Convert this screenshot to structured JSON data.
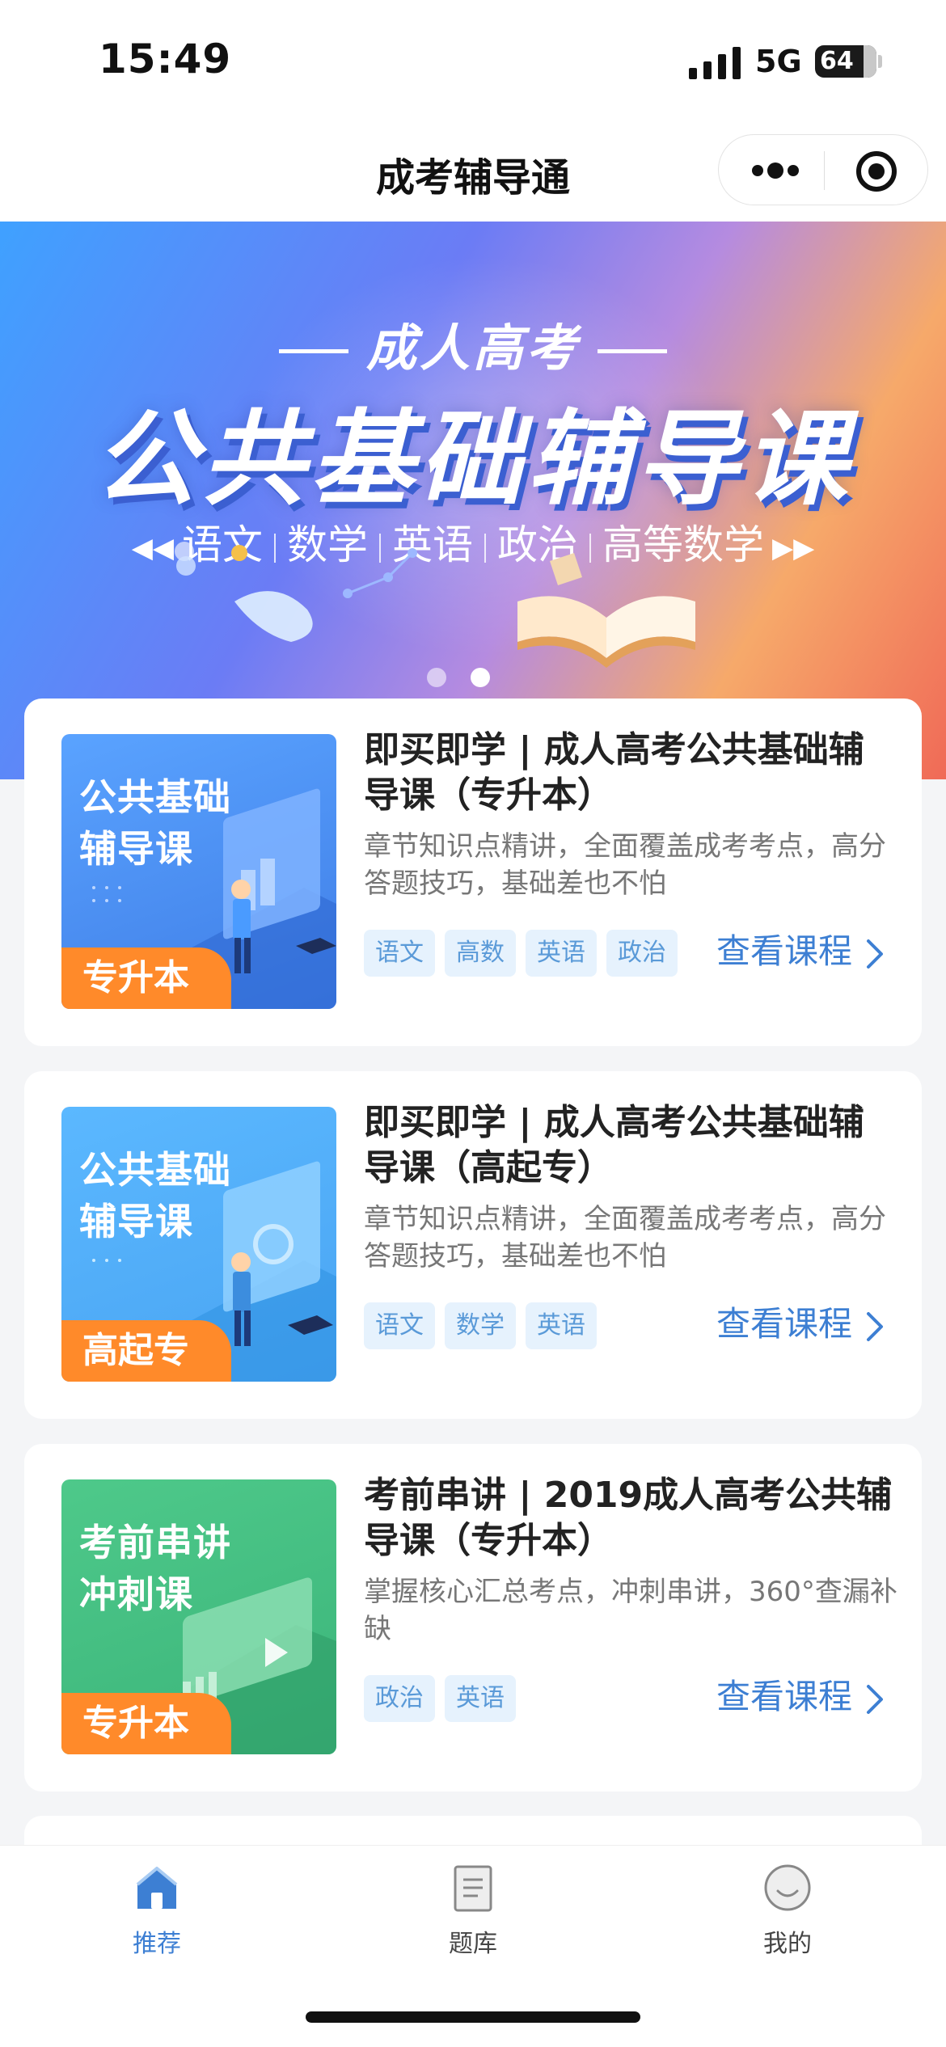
{
  "status_bar": {
    "time": "15:49",
    "network": "5G",
    "battery": "64"
  },
  "nav": {
    "title": "成考辅导通"
  },
  "banner": {
    "subtitle": "成人高考",
    "title": "公共基础辅导课",
    "subjects": [
      "语文",
      "数学",
      "英语",
      "政治",
      "高等数学"
    ],
    "active_slide": 2,
    "slide_count": 2
  },
  "courses": [
    {
      "thumb_text": "公共基础\n辅导课",
      "thumb_badge": "专升本",
      "title": "即买即学 | 成人高考公共基础辅导课（专升本）",
      "description": "章节知识点精讲，全面覆盖成考考点，高分答题技巧，基础差也不怕",
      "tags": [
        "语文",
        "高数",
        "英语",
        "政治"
      ],
      "link_label": "查看课程"
    },
    {
      "thumb_text": "公共基础\n辅导课",
      "thumb_badge": "高起专",
      "title": "即买即学 | 成人高考公共基础辅导课（高起专）",
      "description": "章节知识点精讲，全面覆盖成考考点，高分答题技巧，基础差也不怕",
      "tags": [
        "语文",
        "数学",
        "英语"
      ],
      "link_label": "查看课程"
    },
    {
      "thumb_text": "考前串讲\n冲刺课",
      "thumb_badge": "专升本",
      "title": "考前串讲 | 2019成人高考公共辅导课（专升本）",
      "description": "掌握核心汇总考点，冲刺串讲，360°查漏补缺",
      "tags": [
        "政治",
        "英语"
      ],
      "link_label": "查看课程"
    }
  ],
  "tab_bar": {
    "items": [
      {
        "label": "推荐",
        "icon": "home-icon",
        "active": true
      },
      {
        "label": "题库",
        "icon": "question-bank-icon",
        "active": false
      },
      {
        "label": "我的",
        "icon": "profile-icon",
        "active": false
      }
    ]
  },
  "colors": {
    "accent": "#3d7fd3",
    "tab_active": "#3d7fd3",
    "tab_inactive": "#555555",
    "badge": "#ff8a2a",
    "tag_bg": "#e6f2fd",
    "tag_text": "#5a9ad8"
  }
}
